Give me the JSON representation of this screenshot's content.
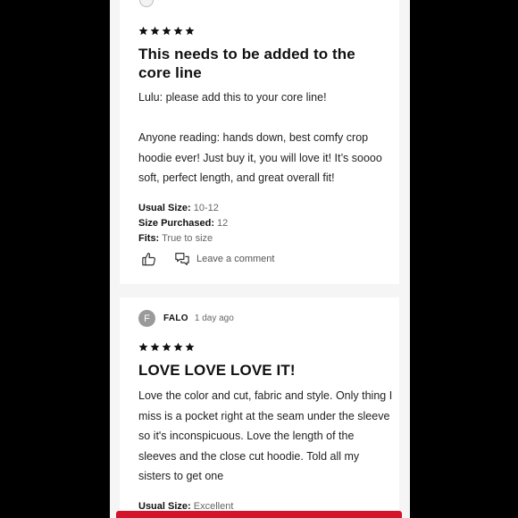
{
  "reviews": [
    {
      "rating": 5,
      "title": "This needs to be added to the core line",
      "body": [
        "Lulu: please add this to your core line!",
        "Anyone reading: hands down, best comfy crop hoodie ever! Just buy it, you will love it! It’s soooo soft, perfect length, and great overall fit!"
      ],
      "usual_size_label": "Usual Size:",
      "usual_size": "10-12",
      "size_purchased_label": "Size Purchased:",
      "size_purchased": "12",
      "fits_label": "Fits:",
      "fits": "True to size",
      "like_icon": "thumbs-up-icon",
      "comment_icon": "comment-bubbles-icon",
      "comment_label": "Leave a comment"
    },
    {
      "avatar_initial": "F",
      "author": "FALO",
      "date": "1 day ago",
      "rating": 5,
      "title": "LOVE LOVE LOVE IT!",
      "body": "Love the color and cut, fabric and style. Only thing I miss is a pocket right at the seam under the sleeve so it's inconspicuous. Love the length of the sleeves and the close cut hoodie. Told all my sisters to get one",
      "usual_size_label": "Usual Size:",
      "usual_size": "Excellent"
    }
  ],
  "colors": {
    "frame": "#000000",
    "page_background": "#f5f5f5",
    "card": "#ffffff",
    "accent_red": "#d3142a",
    "avatar_gray": "#9a9a9a"
  }
}
